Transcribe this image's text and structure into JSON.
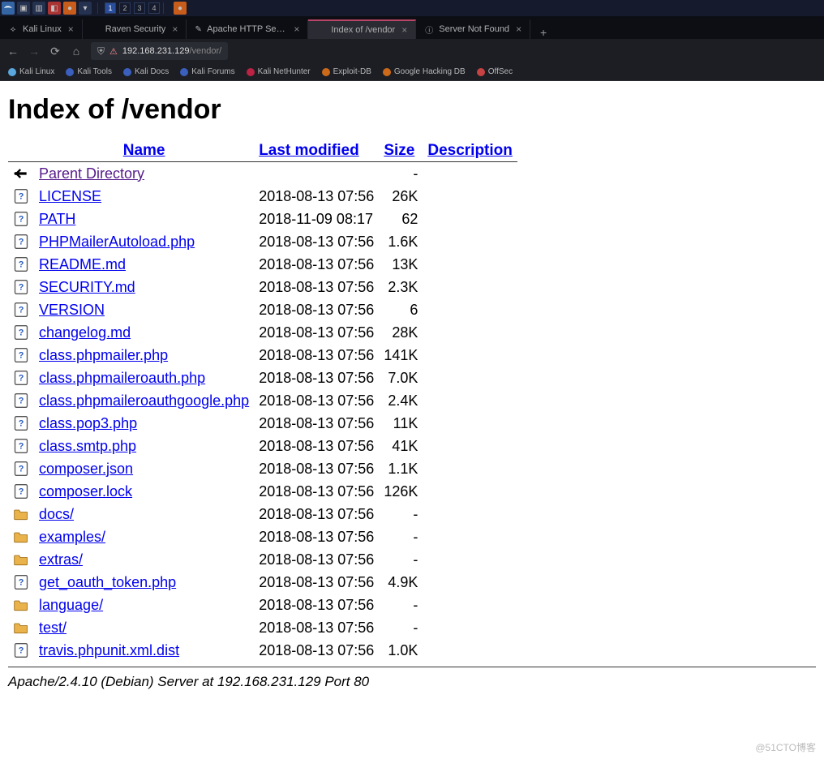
{
  "kali": {
    "workspaces": [
      "1",
      "2",
      "3",
      "4"
    ],
    "active_ws": 0
  },
  "tabs": [
    {
      "label": "Kali Linux",
      "icon": "kali",
      "close": true
    },
    {
      "label": "Raven Security",
      "icon": "blank",
      "close": true
    },
    {
      "label": "Apache HTTP Server Ver…",
      "icon": "feather",
      "close": true
    },
    {
      "label": "Index of /vendor",
      "icon": "blank",
      "close": true,
      "active": true
    },
    {
      "label": "Server Not Found",
      "icon": "info",
      "close": true
    }
  ],
  "new_tab": "+",
  "addr": {
    "url_host": "192.168.231.129",
    "url_path": "/vendor/"
  },
  "bookmarks": [
    {
      "label": "Kali Linux",
      "color": "#5aa7dd"
    },
    {
      "label": "Kali Tools",
      "color": "#3b5fbd"
    },
    {
      "label": "Kali Docs",
      "color": "#3b5fbd"
    },
    {
      "label": "Kali Forums",
      "color": "#3b5fbd"
    },
    {
      "label": "Kali NetHunter",
      "color": "#bb2244"
    },
    {
      "label": "Exploit-DB",
      "color": "#cc6a1a"
    },
    {
      "label": "Google Hacking DB",
      "color": "#cc6a1a"
    },
    {
      "label": "OffSec",
      "color": "#c74343"
    }
  ],
  "page": {
    "heading": "Index of /vendor",
    "columns": {
      "blank": "",
      "name": "Name",
      "modified": "Last modified",
      "size": "Size",
      "desc": "Description"
    },
    "rows": [
      {
        "icon": "back",
        "name": "Parent Directory",
        "visited": true,
        "modified": "",
        "size": "-"
      },
      {
        "icon": "unknown",
        "name": "LICENSE",
        "modified": "2018-08-13 07:56",
        "size": "26K"
      },
      {
        "icon": "unknown",
        "name": "PATH",
        "modified": "2018-11-09 08:17",
        "size": "62"
      },
      {
        "icon": "unknown",
        "name": "PHPMailerAutoload.php",
        "modified": "2018-08-13 07:56",
        "size": "1.6K"
      },
      {
        "icon": "unknown",
        "name": "README.md",
        "modified": "2018-08-13 07:56",
        "size": "13K"
      },
      {
        "icon": "unknown",
        "name": "SECURITY.md",
        "modified": "2018-08-13 07:56",
        "size": "2.3K"
      },
      {
        "icon": "unknown",
        "name": "VERSION",
        "modified": "2018-08-13 07:56",
        "size": "6"
      },
      {
        "icon": "unknown",
        "name": "changelog.md",
        "modified": "2018-08-13 07:56",
        "size": "28K"
      },
      {
        "icon": "unknown",
        "name": "class.phpmailer.php",
        "modified": "2018-08-13 07:56",
        "size": "141K"
      },
      {
        "icon": "unknown",
        "name": "class.phpmaileroauth.php",
        "modified": "2018-08-13 07:56",
        "size": "7.0K"
      },
      {
        "icon": "unknown",
        "name": "class.phpmaileroauthgoogle.php",
        "modified": "2018-08-13 07:56",
        "size": "2.4K"
      },
      {
        "icon": "unknown",
        "name": "class.pop3.php",
        "modified": "2018-08-13 07:56",
        "size": "11K"
      },
      {
        "icon": "unknown",
        "name": "class.smtp.php",
        "modified": "2018-08-13 07:56",
        "size": "41K"
      },
      {
        "icon": "unknown",
        "name": "composer.json",
        "modified": "2018-08-13 07:56",
        "size": "1.1K"
      },
      {
        "icon": "unknown",
        "name": "composer.lock",
        "modified": "2018-08-13 07:56",
        "size": "126K"
      },
      {
        "icon": "folder",
        "name": "docs/",
        "modified": "2018-08-13 07:56",
        "size": "-"
      },
      {
        "icon": "folder",
        "name": "examples/",
        "modified": "2018-08-13 07:56",
        "size": "-"
      },
      {
        "icon": "folder",
        "name": "extras/",
        "modified": "2018-08-13 07:56",
        "size": "-"
      },
      {
        "icon": "unknown",
        "name": "get_oauth_token.php",
        "modified": "2018-08-13 07:56",
        "size": "4.9K"
      },
      {
        "icon": "folder",
        "name": "language/",
        "modified": "2018-08-13 07:56",
        "size": "-"
      },
      {
        "icon": "folder",
        "name": "test/",
        "modified": "2018-08-13 07:56",
        "size": "-"
      },
      {
        "icon": "unknown",
        "name": "travis.phpunit.xml.dist",
        "modified": "2018-08-13 07:56",
        "size": "1.0K"
      }
    ],
    "server_sig": "Apache/2.4.10 (Debian) Server at 192.168.231.129 Port 80"
  },
  "watermark": "@51CTO博客"
}
